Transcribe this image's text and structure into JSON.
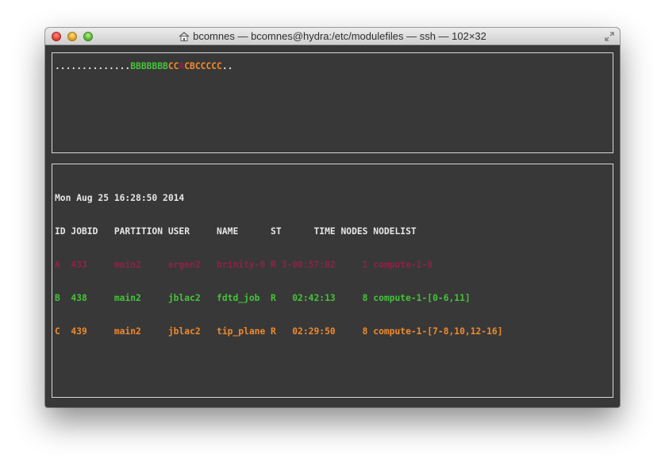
{
  "window": {
    "title": "bcomnes — bcomnes@hydra:/etc/modulefiles — ssh — 102×32",
    "icon": "house-icon"
  },
  "progress": {
    "dots": "..............",
    "b_run": "BBBBBBB",
    "c_run1": "CC",
    "a_mark": "A",
    "c_run2": "CBCCCCC",
    "tail": ".."
  },
  "queue": {
    "timestamp": "Mon Aug 25 16:28:50 2014",
    "header": "ID JOBID   PARTITION USER     NAME      ST      TIME NODES NODELIST",
    "rows": [
      {
        "line": "A  433     main2     ergen2   brinity-0 R 3-00:57:02     1 compute-1-0",
        "state": "ended"
      },
      {
        "line": "B  438     main2     jblac2   fdtd_job  R   02:42:13     8 compute-1-[0-6,11]",
        "state": "running-b"
      },
      {
        "line": "C  439     main2     jblac2   tip_plane R   02:29:50     8 compute-1-[7-8,10,12-16]",
        "state": "running-c"
      }
    ]
  },
  "colors": {
    "ended": "#8c2348",
    "job_b": "#45c23a",
    "job_c": "#ef8a2d",
    "background": "#383838"
  }
}
